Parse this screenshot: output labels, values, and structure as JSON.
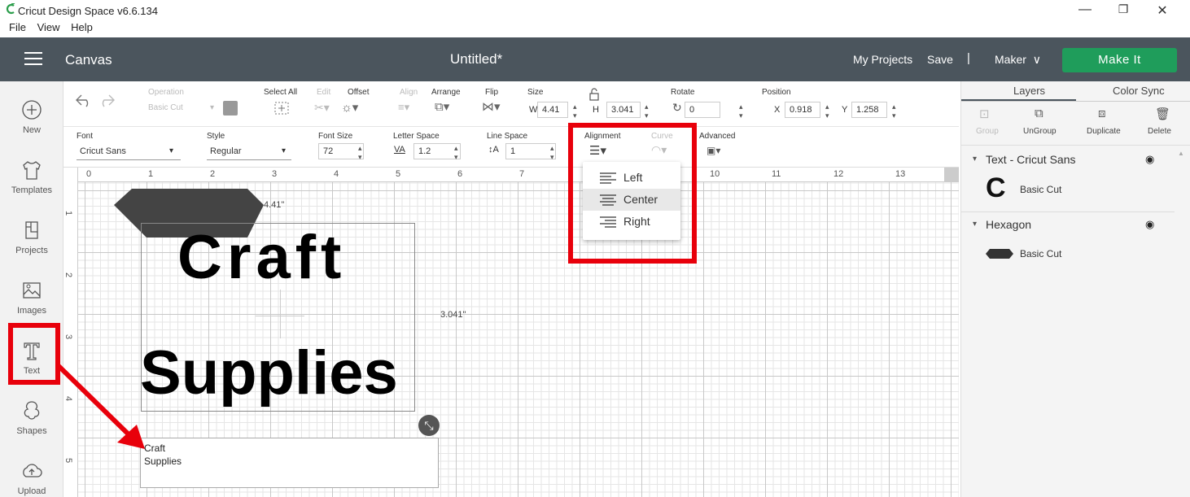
{
  "window": {
    "title": "Cricut Design Space  v6.6.134",
    "minimize": "—",
    "restore": "❐",
    "close": "✕"
  },
  "menu": [
    "File",
    "View",
    "Help"
  ],
  "header": {
    "section": "Canvas",
    "project_title": "Untitled*",
    "my_projects": "My Projects",
    "save": "Save",
    "separator": "|",
    "machine": "Maker",
    "make_it": "Make It"
  },
  "leftbar": [
    {
      "label": "New",
      "icon": "plus-circle-icon"
    },
    {
      "label": "Templates",
      "icon": "shirt-icon"
    },
    {
      "label": "Projects",
      "icon": "projects-icon"
    },
    {
      "label": "Images",
      "icon": "image-icon"
    },
    {
      "label": "Text",
      "icon": "text-icon"
    },
    {
      "label": "Shapes",
      "icon": "shapes-icon"
    },
    {
      "label": "Upload",
      "icon": "upload-icon"
    }
  ],
  "toolbar1": {
    "operation_label": "Operation",
    "operation_value": "Basic Cut",
    "select_all": "Select All",
    "edit": "Edit",
    "offset": "Offset",
    "align": "Align",
    "arrange": "Arrange",
    "flip": "Flip",
    "size": "Size",
    "w_label": "W",
    "w_value": "4.41",
    "h_label": "H",
    "h_value": "3.041",
    "rotate": "Rotate",
    "rotate_value": "0",
    "position": "Position",
    "x_label": "X",
    "x_value": "0.918",
    "y_label": "Y",
    "y_value": "1.258"
  },
  "toolbar2": {
    "font_label": "Font",
    "font_value": "Cricut Sans",
    "style_label": "Style",
    "style_value": "Regular",
    "font_size_label": "Font Size",
    "font_size_value": "72",
    "letter_space_label": "Letter Space",
    "letter_space_value": "1.2",
    "line_space_label": "Line Space",
    "line_space_value": "1",
    "alignment_label": "Alignment",
    "curve_label": "Curve",
    "advanced_label": "Advanced"
  },
  "alignment_menu": {
    "items": [
      "Left",
      "Center",
      "Right"
    ],
    "selected": "Center"
  },
  "ruler": {
    "top": [
      "0",
      "1",
      "2",
      "3",
      "4",
      "5",
      "6",
      "7",
      "10",
      "11",
      "12",
      "13"
    ],
    "left": [
      "1",
      "2",
      "3",
      "4",
      "5"
    ]
  },
  "canvas": {
    "width_dim": "4.41\"",
    "height_dim": "3.041\"",
    "text_line1": "Craft",
    "text_line2": "Supplies",
    "textbox": "Craft\nSupplies"
  },
  "rightpanel": {
    "tabs": [
      "Layers",
      "Color Sync"
    ],
    "buttons": [
      "Group",
      "UnGroup",
      "Duplicate",
      "Delete"
    ],
    "groups": [
      {
        "name": "Text - Cricut Sans",
        "layer": "Basic Cut",
        "thumb": "C"
      },
      {
        "name": "Hexagon",
        "layer": "Basic Cut"
      }
    ]
  },
  "colors": {
    "header": "#4b555d",
    "make_it": "#1f9d5b",
    "highlight": "#e8000b",
    "hexagon": "#444444"
  }
}
